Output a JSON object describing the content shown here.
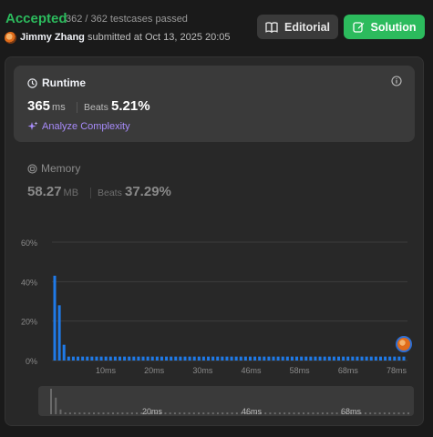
{
  "header": {
    "status": "Accepted",
    "testcases": "362 / 362 testcases passed",
    "username": "Jimmy Zhang",
    "submitted_text": "submitted at Oct 13, 2025 20:05",
    "editorial_label": "Editorial",
    "solution_label": "Solution"
  },
  "runtime": {
    "title": "Runtime",
    "value": "365",
    "unit": "ms",
    "beats_label": "Beats",
    "beats_value": "5.21%",
    "analyze_label": "Analyze Complexity"
  },
  "memory": {
    "title": "Memory",
    "value": "58.27",
    "unit": "MB",
    "beats_label": "Beats",
    "beats_value": "37.29%"
  },
  "colors": {
    "accent_green": "#2cbb5d",
    "bar_blue": "#1f7ae8",
    "analyze_purple": "#a78bfa"
  },
  "chart_data": {
    "type": "bar",
    "title": "",
    "xlabel": "",
    "ylabel": "",
    "y_ticks": [
      "0%",
      "20%",
      "40%",
      "60%"
    ],
    "ylim": [
      0,
      60
    ],
    "x_ticks": [
      "10ms",
      "20ms",
      "30ms",
      "46ms",
      "58ms",
      "68ms",
      "78ms"
    ],
    "series": [
      {
        "values": [
          43,
          28,
          8,
          2,
          2,
          2,
          2,
          2,
          2,
          2,
          2,
          2,
          2,
          2,
          2,
          2,
          2,
          2,
          2,
          2,
          2,
          2,
          2,
          2,
          2,
          2,
          2,
          2,
          2,
          2,
          2,
          2,
          2,
          2,
          2,
          2,
          2,
          2,
          2,
          2,
          2,
          2,
          2,
          2,
          2,
          2,
          2,
          2,
          2,
          2,
          2,
          2,
          2,
          2,
          2,
          2,
          2,
          2,
          2,
          2,
          2,
          2,
          2,
          2,
          2,
          2,
          2,
          2,
          2,
          2,
          2,
          2,
          2,
          2,
          2,
          2
        ]
      }
    ],
    "user_marker_bar": 75,
    "grid": true,
    "mini_x_ticks": [
      "20ms",
      "46ms",
      "68ms"
    ]
  }
}
